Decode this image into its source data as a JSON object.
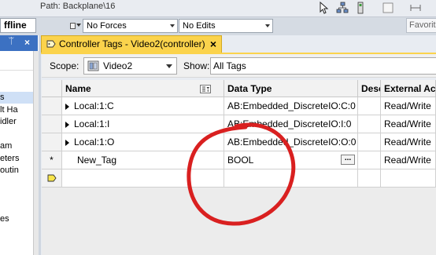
{
  "toolbar": {
    "mode": "ffline",
    "path_label": "Path: Backplane\\16",
    "forces": "No Forces",
    "edits": "No Edits",
    "favorites": "Favorit"
  },
  "left_pane": {
    "pin_glyph": "ᛠ",
    "close_glyph": "×",
    "items": [
      {
        "label": "s",
        "selected": true
      },
      {
        "label": "lt Ha",
        "selected": false
      },
      {
        "label": "idler",
        "selected": false
      },
      {
        "label": "",
        "selected": false
      },
      {
        "label": "am",
        "selected": false
      },
      {
        "label": "eters",
        "selected": false
      },
      {
        "label": "outin",
        "selected": false
      },
      {
        "label": "",
        "selected": false
      },
      {
        "label": "",
        "selected": false
      },
      {
        "label": "",
        "selected": false
      },
      {
        "label": "es",
        "selected": false
      },
      {
        "label": "",
        "selected": false
      }
    ]
  },
  "tab": {
    "title": "Controller Tags - Video2(controller)",
    "close_glyph": "×"
  },
  "scope": {
    "label": "Scope:",
    "value": "Video2",
    "show_label": "Show:",
    "show_value": "All Tags"
  },
  "grid": {
    "columns": [
      "Name",
      "Data Type",
      "Desc",
      "External Acc"
    ],
    "rows": [
      {
        "marker": "",
        "expand": true,
        "name": "Local:1:C",
        "type": "AB:Embedded_DiscreteIO:C:0",
        "desc": "",
        "access": "Read/Write"
      },
      {
        "marker": "",
        "expand": true,
        "name": "Local:1:I",
        "type": "AB:Embedded_DiscreteIO:I:0",
        "desc": "",
        "access": "Read/Write"
      },
      {
        "marker": "",
        "expand": true,
        "name": "Local:1:O",
        "type": "AB:Embedded_DiscreteIO:O:0",
        "desc": "",
        "access": "Read/Write"
      },
      {
        "marker": "*",
        "expand": false,
        "name": "New_Tag",
        "type": "BOOL",
        "desc": "",
        "access": "Read/Write"
      }
    ],
    "ellipsis_label": "..."
  },
  "colors": {
    "tab_accent": "#fbd34c",
    "left_header": "#3c71c2",
    "annotation": "#d92020"
  }
}
